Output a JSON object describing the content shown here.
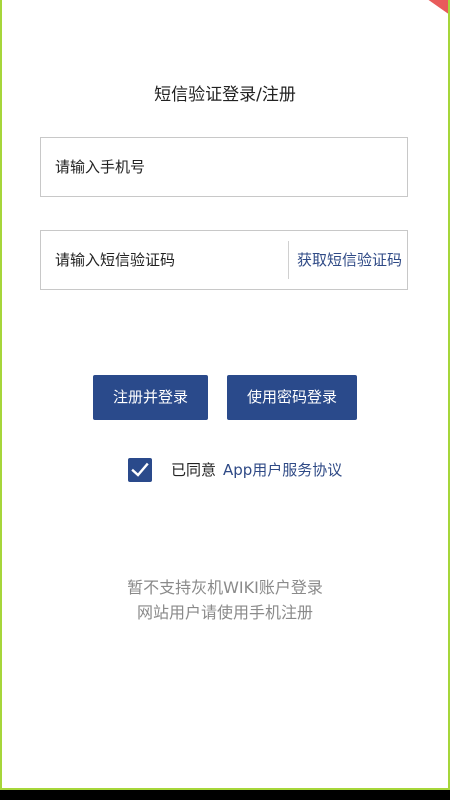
{
  "page": {
    "title": "短信验证登录/注册"
  },
  "form": {
    "phone_placeholder": "请输入手机号",
    "code_placeholder": "请输入短信验证码",
    "get_code_label": "获取短信验证码"
  },
  "actions": {
    "register_login_label": "注册并登录",
    "password_login_label": "使用密码登录"
  },
  "agreement": {
    "checked": true,
    "prefix": "已同意",
    "link_label": "App用户服务协议"
  },
  "notice": {
    "line1": "暂不支持灰机WIKI账户登录",
    "line2": "网站用户请使用手机注册"
  },
  "colors": {
    "primary": "#2a4a8b",
    "link": "#2f4a86",
    "muted": "#8a8a8a",
    "frame": "#a6d63a"
  }
}
